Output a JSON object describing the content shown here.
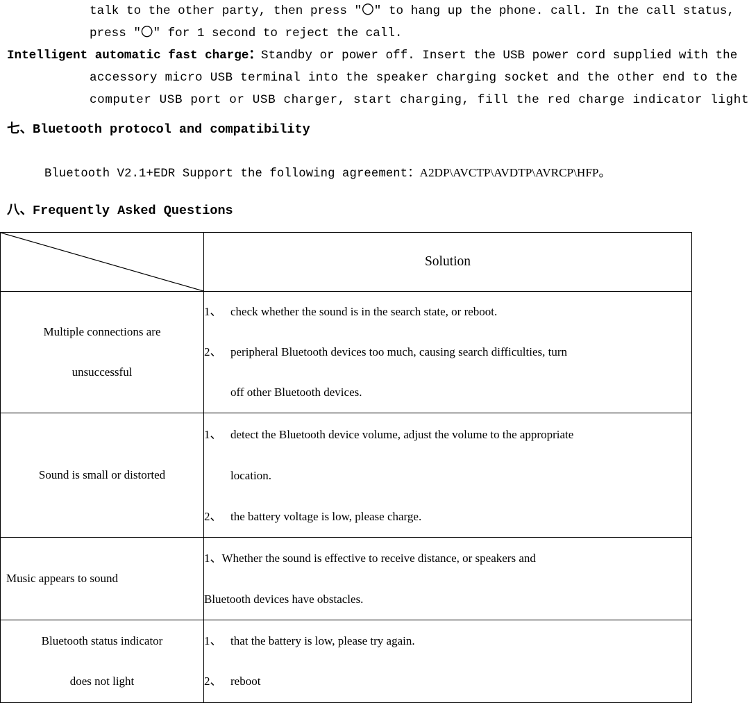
{
  "body_paragraph": {
    "lines": [
      "talk to the other party, then press \"〇\" to hang up the phone. call. In the call status,",
      "press \"〇\" for 1 second to reject the call."
    ]
  },
  "fast_charge": {
    "label": "Intelligent automatic fast charge：",
    "line1": "Standby or power off. Insert the USB power cord supplied with the",
    "line2": "accessory micro USB terminal into the speaker charging socket and the other end to the",
    "line3": "computer USB port or USB charger, start charging, fill the red charge indicator light off."
  },
  "sections": {
    "protocol_heading": "七、Bluetooth protocol and compatibility",
    "protocol_text_prefix": "Bluetooth V2.1+EDR Support the following agreement：",
    "protocol_text_value": "A2DP\\AVCTP\\AVDTP\\AVRCP\\HFP",
    "protocol_text_suffix": "。",
    "faq_heading": "八、Frequently Asked Questions"
  },
  "faq_table": {
    "header": {
      "question_column": "",
      "solution_column": "Solution"
    },
    "rows": [
      {
        "question_line1": "Multiple connections are",
        "question_line2": "unsuccessful",
        "answers": [
          {
            "marker": "1、",
            "text": "check whether the sound is in the search state, or reboot."
          },
          {
            "marker": "2、",
            "text": "peripheral Bluetooth devices too much, causing search difficulties, turn",
            "continuation": "off other Bluetooth devices."
          }
        ]
      },
      {
        "question_line1": "Sound is small or distorted",
        "question_line2": "",
        "answers": [
          {
            "marker": "1、",
            "text": "detect the Bluetooth device volume, adjust the volume to the appropriate",
            "continuation": "location."
          },
          {
            "marker": "2、",
            "text": "  the battery voltage is low, please charge."
          }
        ]
      },
      {
        "question_line1": "Music appears to sound",
        "question_line2": "",
        "answers": [
          {
            "marker": "1、",
            "text": "Whether the sound is effective to receive distance, or speakers and",
            "continuation": "Bluetooth devices have obstacles."
          }
        ]
      },
      {
        "question_line1": "Bluetooth status indicator",
        "question_line2": "does not light",
        "answers": [
          {
            "marker": "1、",
            "text": "that the battery is low, please try again."
          },
          {
            "marker": "2、",
            "text": "reboot"
          }
        ]
      }
    ]
  }
}
